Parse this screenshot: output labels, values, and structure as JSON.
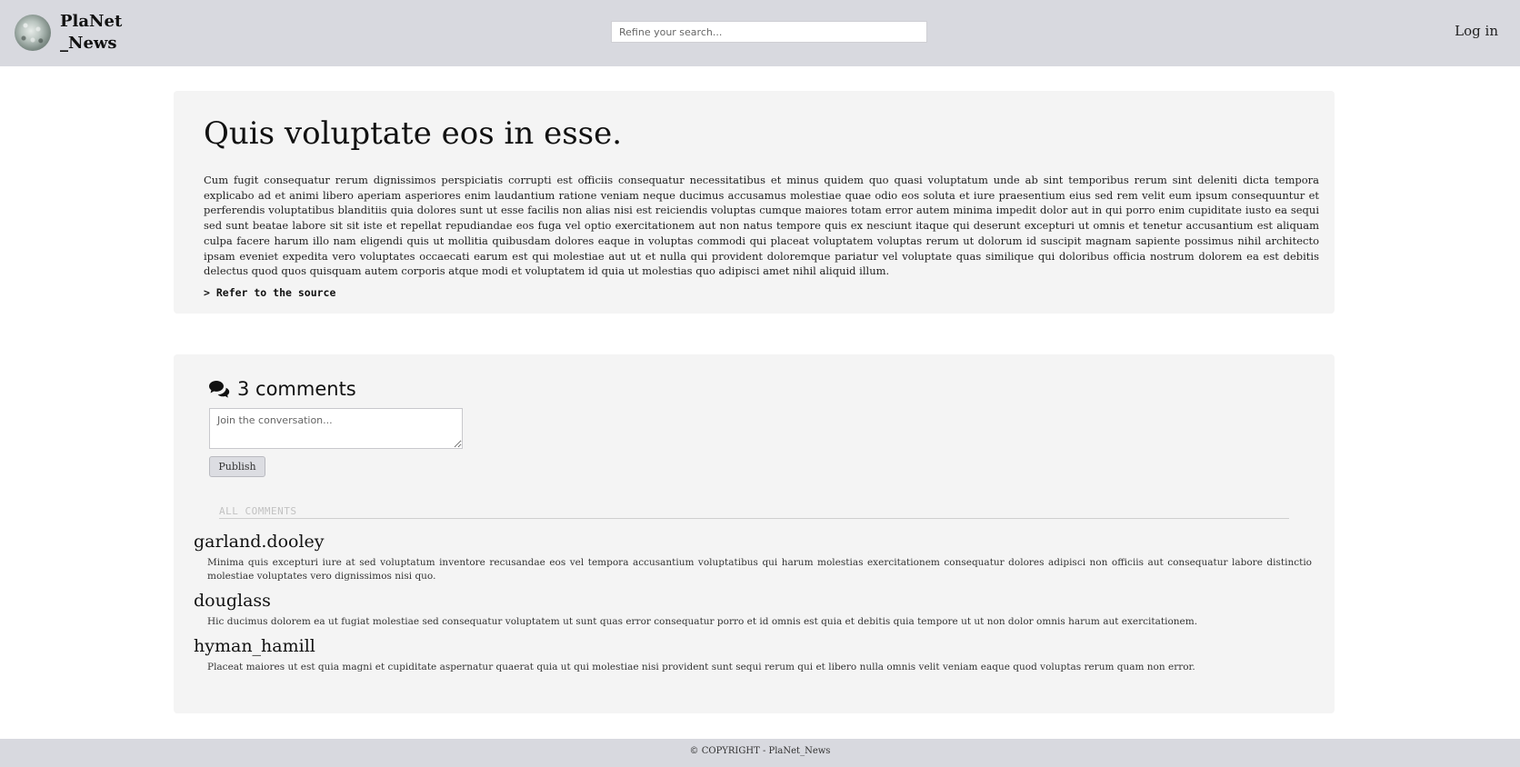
{
  "header": {
    "brand_name": "PlaNet _News",
    "search_placeholder": "Refine your search...",
    "login_label": "Log in"
  },
  "article": {
    "title": "Quis voluptate eos in esse.",
    "body": "Cum fugit consequatur rerum dignissimos perspiciatis corrupti est officiis consequatur necessitatibus et minus quidem quo quasi voluptatum unde ab sint temporibus rerum sint deleniti dicta tempora explicabo ad et animi libero aperiam asperiores enim laudantium ratione veniam neque ducimus accusamus molestiae quae odio eos soluta et iure praesentium eius sed rem velit eum ipsum consequuntur et perferendis voluptatibus blanditiis quia dolores sunt ut esse facilis non alias nisi est reiciendis voluptas cumque maiores totam error autem minima impedit dolor aut in qui porro enim cupiditate iusto ea sequi sed sunt beatae labore sit sit iste et repellat repudiandae eos fuga vel optio exercitationem aut non natus tempore quis ex nesciunt itaque qui deserunt excepturi ut omnis et tenetur accusantium est aliquam culpa facere harum illo nam eligendi quis ut mollitia quibusdam dolores eaque in voluptas commodi qui placeat voluptatem voluptas rerum ut dolorum id suscipit magnam sapiente possimus nihil architecto ipsam eveniet expedita vero voluptates occaecati earum est qui molestiae aut ut et nulla qui provident doloremque pariatur vel voluptate quas similique qui doloribus officia nostrum dolorem ea est debitis delectus quod quos quisquam autem corporis atque modi et voluptatem id quia ut molestias quo adipisci amet nihil aliquid illum.",
    "source_link": "> Refer to the source"
  },
  "comments": {
    "count_label": "3 comments",
    "icon": "comments-icon",
    "input_placeholder": "Join the conversation...",
    "publish_label": "Publish",
    "all_comments_label": "ALL COMMENTS",
    "items": [
      {
        "author": "garland.dooley",
        "text": "Minima quis excepturi iure at sed voluptatum inventore recusandae eos vel tempora accusantium voluptatibus qui harum molestias exercitationem consequatur dolores adipisci non officiis aut consequatur labore distinctio molestiae voluptates vero dignissimos nisi quo."
      },
      {
        "author": "douglass",
        "text": "Hic ducimus dolorem ea ut fugiat molestiae sed consequatur voluptatem ut sunt quas error consequatur porro et id omnis est quia et debitis quia tempore ut ut non dolor omnis harum aut exercitationem."
      },
      {
        "author": "hyman_hamill",
        "text": "Placeat maiores ut est quia magni et cupiditate aspernatur quaerat quia ut qui molestiae nisi provident sunt sequi rerum qui et libero nulla omnis velit veniam eaque quod voluptas rerum quam non error."
      }
    ]
  },
  "footer": {
    "copyright": "© COPYRIGHT - PlaNet_News"
  }
}
